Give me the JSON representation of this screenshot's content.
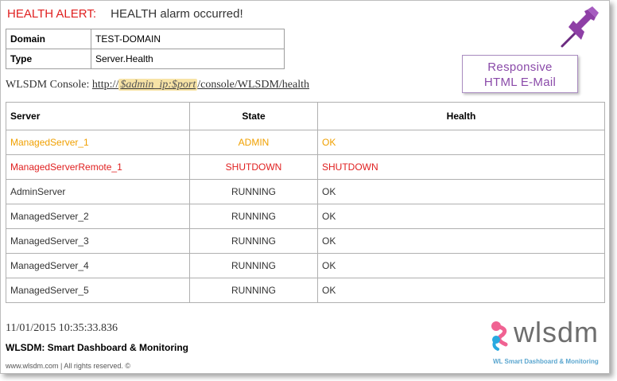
{
  "alert": {
    "label": "HEALTH ALERT:",
    "message": "HEALTH alarm occurred!"
  },
  "info_table": [
    {
      "key": "Domain",
      "value": "TEST-DOMAIN"
    },
    {
      "key": "Type",
      "value": "Server.Health"
    }
  ],
  "console": {
    "label": "WLSDM Console:",
    "url_prefix": "http://",
    "url_variable": "$admin_ip:$port",
    "url_suffix": "/console/WLSDM/health"
  },
  "badge": {
    "line1": "Responsive",
    "line2": "HTML E-Mail"
  },
  "servers_table": {
    "headers": [
      "Server",
      "State",
      "Health"
    ],
    "rows": [
      {
        "server": "ManagedServer_1",
        "state": "ADMIN",
        "health": "OK",
        "color": "#f0a000"
      },
      {
        "server": "ManagedServerRemote_1",
        "state": "SHUTDOWN",
        "health": "SHUTDOWN",
        "color": "#e02020"
      },
      {
        "server": "AdminServer",
        "state": "RUNNING",
        "health": "OK",
        "color": "#333333"
      },
      {
        "server": "ManagedServer_2",
        "state": "RUNNING",
        "health": "OK",
        "color": "#333333"
      },
      {
        "server": "ManagedServer_3",
        "state": "RUNNING",
        "health": "OK",
        "color": "#333333"
      },
      {
        "server": "ManagedServer_4",
        "state": "RUNNING",
        "health": "OK",
        "color": "#333333"
      },
      {
        "server": "ManagedServer_5",
        "state": "RUNNING",
        "health": "OK",
        "color": "#333333"
      }
    ]
  },
  "timestamp": "11/01/2015 10:35:33.836",
  "tagline": "WLSDM: Smart Dashboard & Monitoring",
  "footer": "www.wlsdm.com | All rights reserved. ©",
  "logo": {
    "text": "wlsdm",
    "subtitle": "WL Smart Dashboard & Monitoring"
  },
  "icons": {
    "pin": "pushpin-icon",
    "logo_mark": "wlsdm-logo-mark"
  },
  "colors": {
    "alert": "#e02020",
    "warning": "#f0a000",
    "badge": "#8a4aa9",
    "pin": "#8e3fa6"
  }
}
